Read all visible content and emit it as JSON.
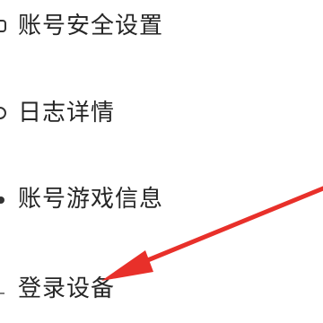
{
  "menu": {
    "items": [
      {
        "label": "账号安全设置",
        "icon": "shield-icon"
      },
      {
        "label": "日志详情",
        "icon": "log-icon"
      },
      {
        "label": "账号游戏信息",
        "icon": "game-info-icon"
      },
      {
        "label": "登录设备",
        "icon": "device-icon"
      }
    ]
  },
  "annotation": {
    "arrow_color": "#e8302a",
    "target": "登录设备"
  }
}
